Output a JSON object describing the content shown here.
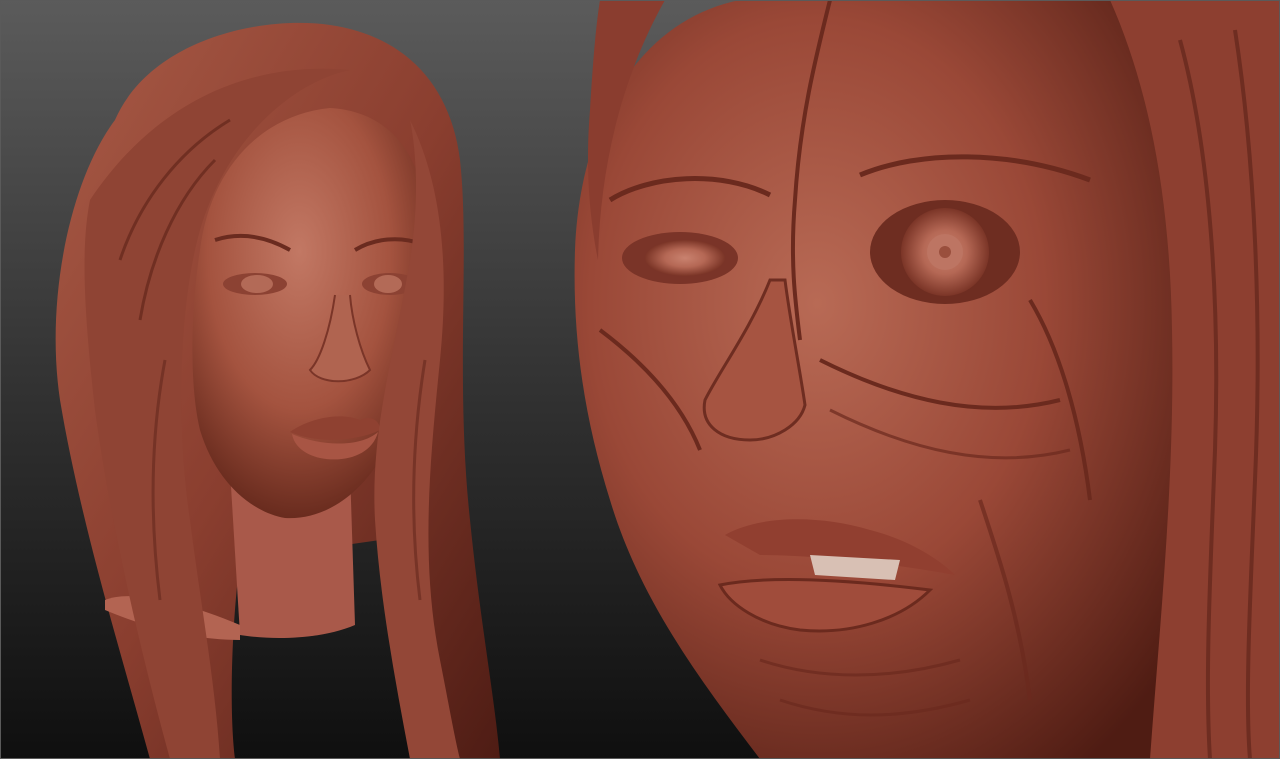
{
  "scene": {
    "background_top": "#5b5b5b",
    "background_bottom": "#111111",
    "clay_light": "#c0735f",
    "clay_mid": "#9a4c3b",
    "clay_dark": "#4e1d15"
  },
  "sculpts": [
    {
      "name": "female-head-sculpt"
    },
    {
      "name": "decayed-face-closeup-sculpt"
    }
  ]
}
